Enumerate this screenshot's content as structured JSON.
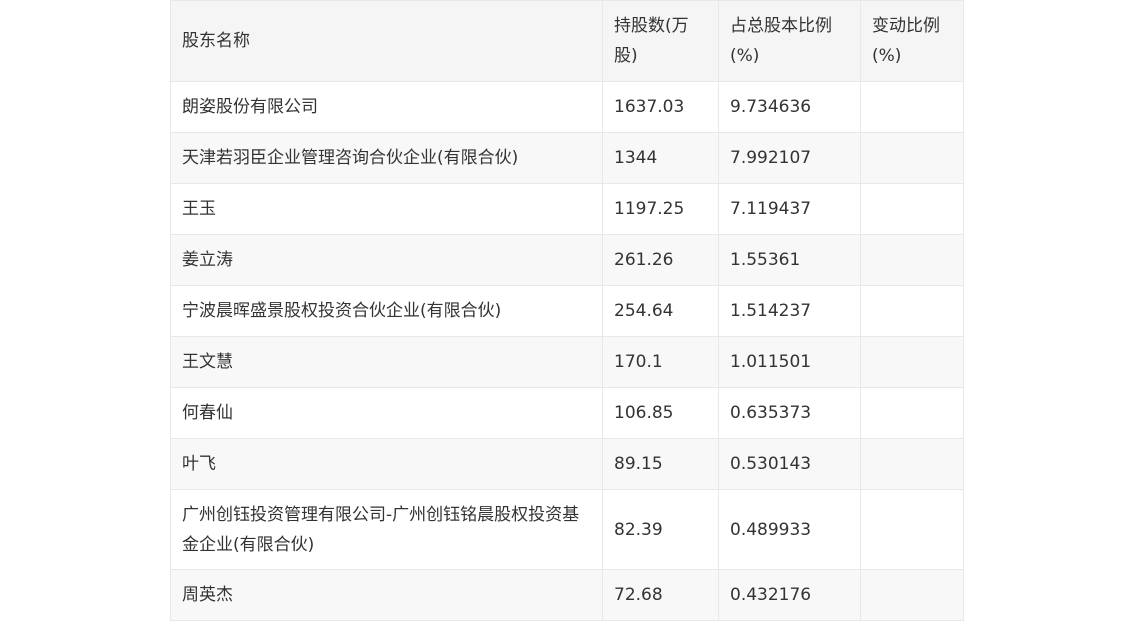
{
  "table": {
    "headers": [
      "股东名称",
      "持股数(万股)",
      "占总股本比例(%)",
      "变动比例(%)"
    ],
    "rows": [
      [
        "朗姿股份有限公司",
        "1637.03",
        "9.734636",
        ""
      ],
      [
        "天津若羽臣企业管理咨询合伙企业(有限合伙)",
        "1344",
        "7.992107",
        ""
      ],
      [
        "王玉",
        "1197.25",
        "7.119437",
        ""
      ],
      [
        "姜立涛",
        "261.26",
        "1.55361",
        ""
      ],
      [
        "宁波晨晖盛景股权投资合伙企业(有限合伙)",
        "254.64",
        "1.514237",
        ""
      ],
      [
        "王文慧",
        "170.1",
        "1.011501",
        ""
      ],
      [
        "何春仙",
        "106.85",
        "0.635373",
        ""
      ],
      [
        "叶飞",
        "89.15",
        "0.530143",
        ""
      ],
      [
        "广州创钰投资管理有限公司-广州创钰铭晨股权投资基金企业(有限合伙)",
        "82.39",
        "0.489933",
        ""
      ],
      [
        "周英杰",
        "72.68",
        "0.432176",
        ""
      ]
    ]
  }
}
